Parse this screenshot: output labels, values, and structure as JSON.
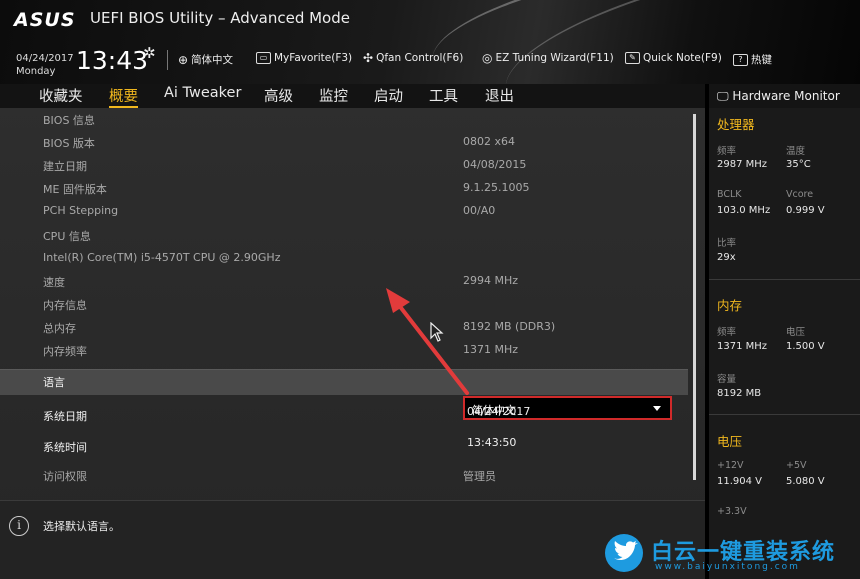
{
  "header": {
    "logo": "ASUS",
    "title": "UEFI BIOS Utility – Advanced Mode",
    "date": "04/24/2017",
    "weekday": "Monday",
    "time": "13:43",
    "toolbar": {
      "language": "简体中文",
      "myfavorite": "MyFavorite(F3)",
      "qfan": "Qfan Control(F6)",
      "ez_tuning": "EZ Tuning Wizard(F11)",
      "quick_note": "Quick Note(F9)",
      "hotkeys": "热键"
    }
  },
  "nav": {
    "tabs": [
      {
        "label": "收藏夹"
      },
      {
        "label": "概要"
      },
      {
        "label": "Ai Tweaker"
      },
      {
        "label": "高级"
      },
      {
        "label": "监控"
      },
      {
        "label": "启动"
      },
      {
        "label": "工具"
      },
      {
        "label": "退出"
      }
    ],
    "active_index": 1
  },
  "main": {
    "rows": [
      {
        "label": "BIOS 信息",
        "value": ""
      },
      {
        "label": "BIOS 版本",
        "value": "0802 x64"
      },
      {
        "label": "建立日期",
        "value": "04/08/2015"
      },
      {
        "label": "ME 固件版本",
        "value": "9.1.25.1005"
      },
      {
        "label": "PCH Stepping",
        "value": "00/A0"
      },
      {
        "label": "CPU 信息",
        "value": ""
      },
      {
        "label": "Intel(R) Core(TM) i5-4570T CPU @ 2.90GHz",
        "value": ""
      },
      {
        "label": "速度",
        "value": "2994 MHz"
      },
      {
        "label": "内存信息",
        "value": ""
      },
      {
        "label": "总内存",
        "value": "8192 MB (DDR3)"
      },
      {
        "label": "内存频率",
        "value": "1371 MHz"
      }
    ],
    "language": {
      "label": "语言",
      "value": "简体中文"
    },
    "system_date": {
      "label": "系统日期",
      "value": "04/24/2017"
    },
    "system_time": {
      "label": "系统时间",
      "value": "13:43:50"
    },
    "access": {
      "label": "访问权限",
      "value": "管理员"
    },
    "help_text": "选择默认语言。"
  },
  "hw_monitor": {
    "title": "Hardware Monitor",
    "cpu": {
      "section": "处理器",
      "freq_label": "频率",
      "freq": "2987 MHz",
      "temp_label": "温度",
      "temp": "35°C",
      "bclk_label": "BCLK",
      "bclk": "103.0 MHz",
      "vcore_label": "Vcore",
      "vcore": "0.999 V",
      "ratio_label": "比率",
      "ratio": "29x"
    },
    "memory": {
      "section": "内存",
      "freq_label": "频率",
      "freq": "1371 MHz",
      "volt_label": "电压",
      "volt": "1.500 V",
      "cap_label": "容量",
      "cap": "8192 MB"
    },
    "voltage": {
      "section": "电压",
      "v12_label": "+12V",
      "v12": "11.904 V",
      "v5_label": "+5V",
      "v5": "5.080 V",
      "v33_label": "+3.3V"
    }
  },
  "watermark": {
    "text": "白云一键重装系统",
    "url": "www.baiyunxitong.com"
  },
  "colors": {
    "accent": "#f0b71e",
    "highlight_border": "#d02a2a",
    "annotation_arrow": "#e23b3b",
    "watermark": "#1e9be0"
  }
}
